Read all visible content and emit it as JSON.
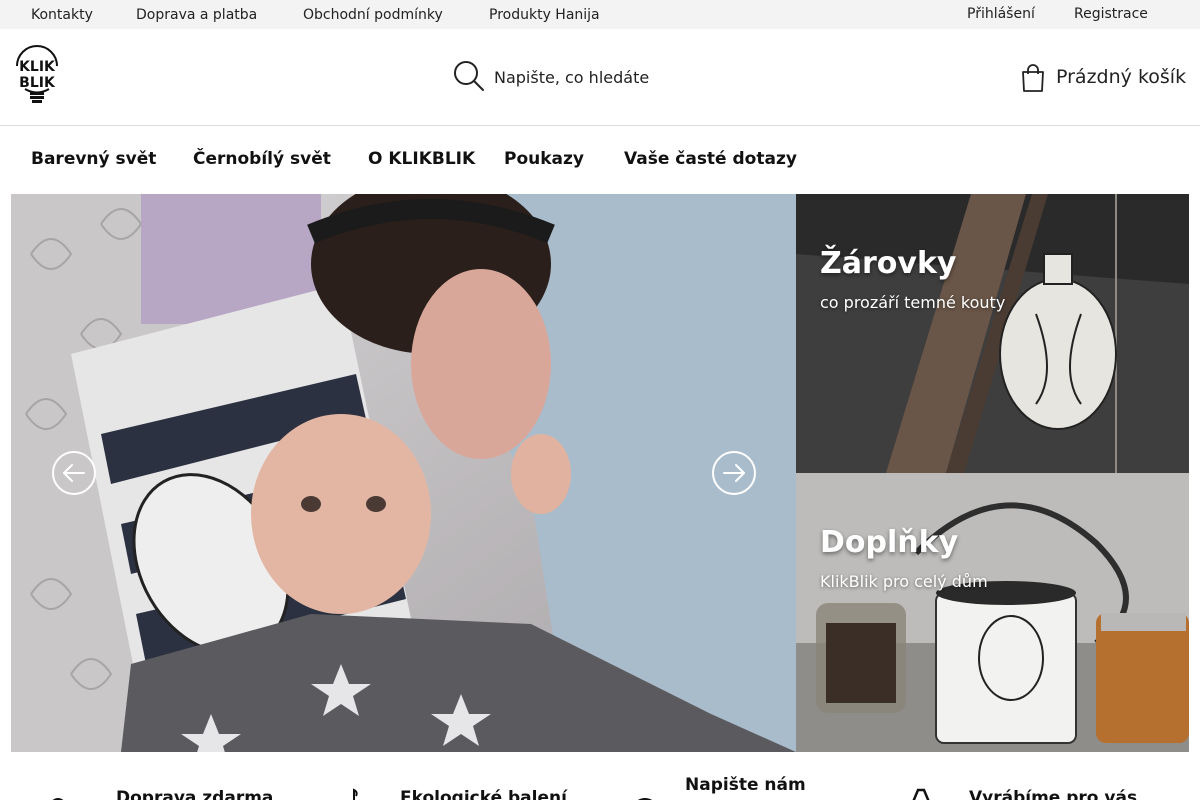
{
  "topbar": {
    "links": [
      "Kontakty",
      "Doprava a platba",
      "Obchodní podmínky",
      "Produkty Hanija"
    ],
    "login": "Přihlášení",
    "register": "Registrace"
  },
  "header": {
    "logo_text": "KLIK BLIK",
    "search_placeholder": "Napište, co hledáte",
    "cart_label": "Prázdný košík"
  },
  "nav": {
    "items": [
      "Barevný svět",
      "Černobílý svět",
      "O KLIKBLIK",
      "Poukazy",
      "Vaše časté dotazy"
    ]
  },
  "tiles": [
    {
      "title": "Žárovky",
      "subtitle": "co prozáří temné kouty"
    },
    {
      "title": "Doplňky",
      "subtitle": "KlikBlik pro celý dům"
    }
  ],
  "benefits": [
    "Doprava zdarma",
    "Ekologické balení",
    "Napište nám",
    "Vyrábíme pro vás"
  ],
  "icons": {
    "search": "search-icon",
    "cart": "shopping-bag-icon",
    "slider_prev": "arrow-left-circle-icon",
    "slider_next": "arrow-right-circle-icon"
  },
  "colors": {
    "topbar_bg": "#f3f3f3",
    "text": "#111111",
    "tile_text": "#ffffff"
  }
}
